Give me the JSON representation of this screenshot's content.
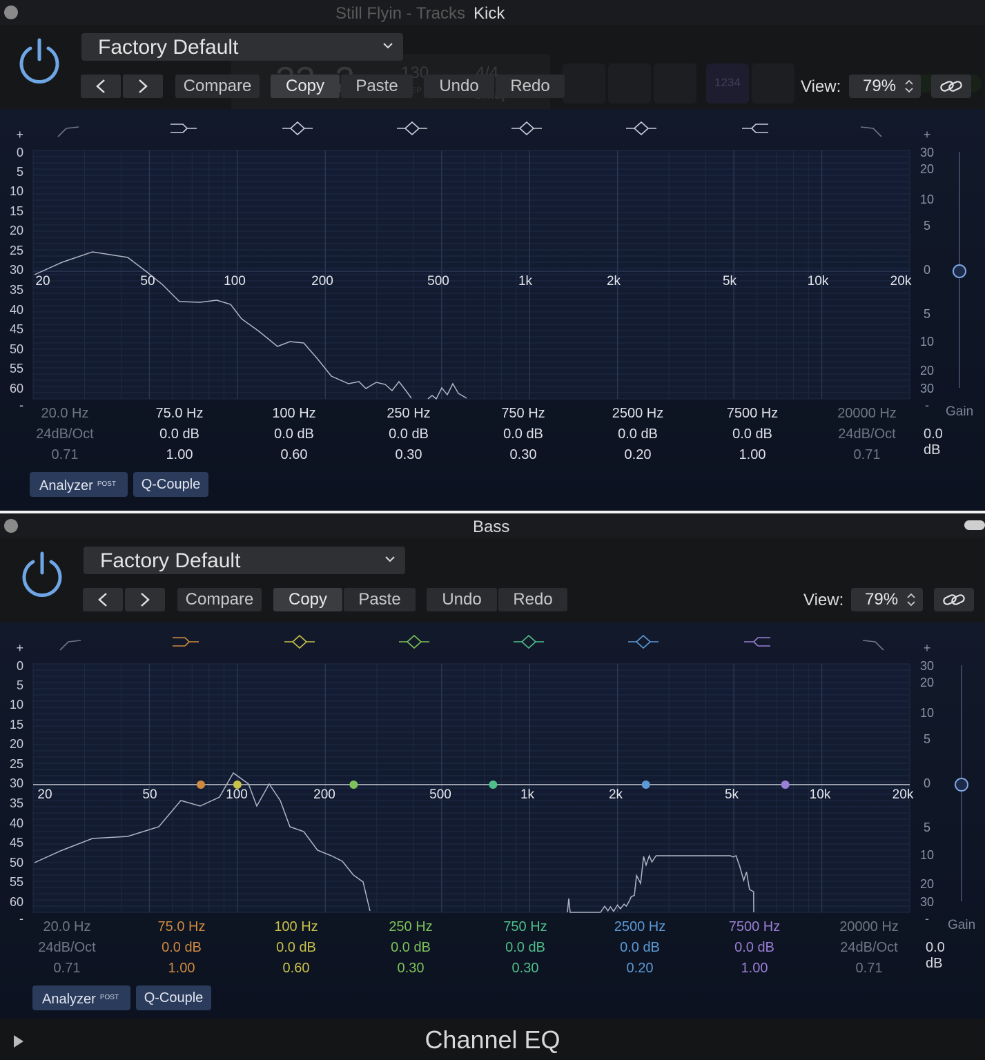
{
  "window1": {
    "title": "Kick",
    "background_title": "Still Flyin - Tracks",
    "background_transport": {
      "bar": "33",
      "beat": "2",
      "tempo": "130",
      "tempo_mode": "KEEP",
      "signature": "4/4",
      "key": "Cmaj"
    },
    "background_counter": "1234",
    "header": {
      "preset": "Factory Default",
      "compare": "Compare",
      "copy": "Copy",
      "paste": "Paste",
      "undo": "Undo",
      "redo": "Redo",
      "view_label": "View:",
      "view_value": "79%"
    },
    "db_left": [
      "+",
      "0",
      "5",
      "10",
      "15",
      "20",
      "25",
      "30",
      "35",
      "40",
      "45",
      "50",
      "55",
      "60",
      "-"
    ],
    "db_right": [
      "+",
      "30",
      "20",
      "10",
      "5",
      "0",
      "5",
      "10",
      "20",
      "30",
      "-"
    ],
    "freq_labels": [
      "20",
      "50",
      "100",
      "200",
      "500",
      "1k",
      "2k",
      "5k",
      "10k",
      "20k"
    ],
    "bands": [
      {
        "freq": "20.0 Hz",
        "gain": "24dB/Oct",
        "q": "0.71"
      },
      {
        "freq": "75.0 Hz",
        "gain": "0.0 dB",
        "q": "1.00"
      },
      {
        "freq": "100 Hz",
        "gain": "0.0 dB",
        "q": "0.60"
      },
      {
        "freq": "250 Hz",
        "gain": "0.0 dB",
        "q": "0.30"
      },
      {
        "freq": "750 Hz",
        "gain": "0.0 dB",
        "q": "0.30"
      },
      {
        "freq": "2500 Hz",
        "gain": "0.0 dB",
        "q": "0.20"
      },
      {
        "freq": "7500 Hz",
        "gain": "0.0 dB",
        "q": "1.00"
      },
      {
        "freq": "20000 Hz",
        "gain": "24dB/Oct",
        "q": "0.71"
      }
    ],
    "gain_label": "Gain",
    "gain_value": "0.0 dB",
    "analyzer": "Analyzer",
    "analyzer_tag": "POST",
    "qcouple": "Q-Couple",
    "band_colors": [
      "#6f7684",
      "#c9ced8",
      "#c9ced8",
      "#c9ced8",
      "#c9ced8",
      "#c9ced8",
      "#c9ced8",
      "#6f7684"
    ]
  },
  "window2": {
    "title": "Bass",
    "header": {
      "preset": "Factory Default",
      "compare": "Compare",
      "copy": "Copy",
      "paste": "Paste",
      "undo": "Undo",
      "redo": "Redo",
      "view_label": "View:",
      "view_value": "79%"
    },
    "db_left": [
      "+",
      "0",
      "5",
      "10",
      "15",
      "20",
      "25",
      "30",
      "35",
      "40",
      "45",
      "50",
      "55",
      "60",
      "-"
    ],
    "db_right": [
      "+",
      "30",
      "20",
      "10",
      "5",
      "0",
      "5",
      "10",
      "20",
      "30",
      "-"
    ],
    "freq_labels": [
      "20",
      "50",
      "100",
      "200",
      "500",
      "1k",
      "2k",
      "5k",
      "10k",
      "20k"
    ],
    "bands": [
      {
        "freq": "20.0 Hz",
        "gain": "24dB/Oct",
        "q": "0.71"
      },
      {
        "freq": "75.0 Hz",
        "gain": "0.0 dB",
        "q": "1.00"
      },
      {
        "freq": "100 Hz",
        "gain": "0.0 dB",
        "q": "0.60"
      },
      {
        "freq": "250 Hz",
        "gain": "0.0 dB",
        "q": "0.30"
      },
      {
        "freq": "750 Hz",
        "gain": "0.0 dB",
        "q": "0.30"
      },
      {
        "freq": "2500 Hz",
        "gain": "0.0 dB",
        "q": "0.20"
      },
      {
        "freq": "7500 Hz",
        "gain": "0.0 dB",
        "q": "1.00"
      },
      {
        "freq": "20000 Hz",
        "gain": "24dB/Oct",
        "q": "0.71"
      }
    ],
    "gain_label": "Gain",
    "gain_value": "0.0 dB",
    "analyzer": "Analyzer",
    "analyzer_tag": "POST",
    "qcouple": "Q-Couple",
    "band_colors": [
      "#6f7684",
      "#d08a3e",
      "#c9c24a",
      "#7cc35a",
      "#4fbf8a",
      "#5d9ad6",
      "#9a7fd6",
      "#6f7684"
    ],
    "footer_title": "Channel EQ"
  }
}
